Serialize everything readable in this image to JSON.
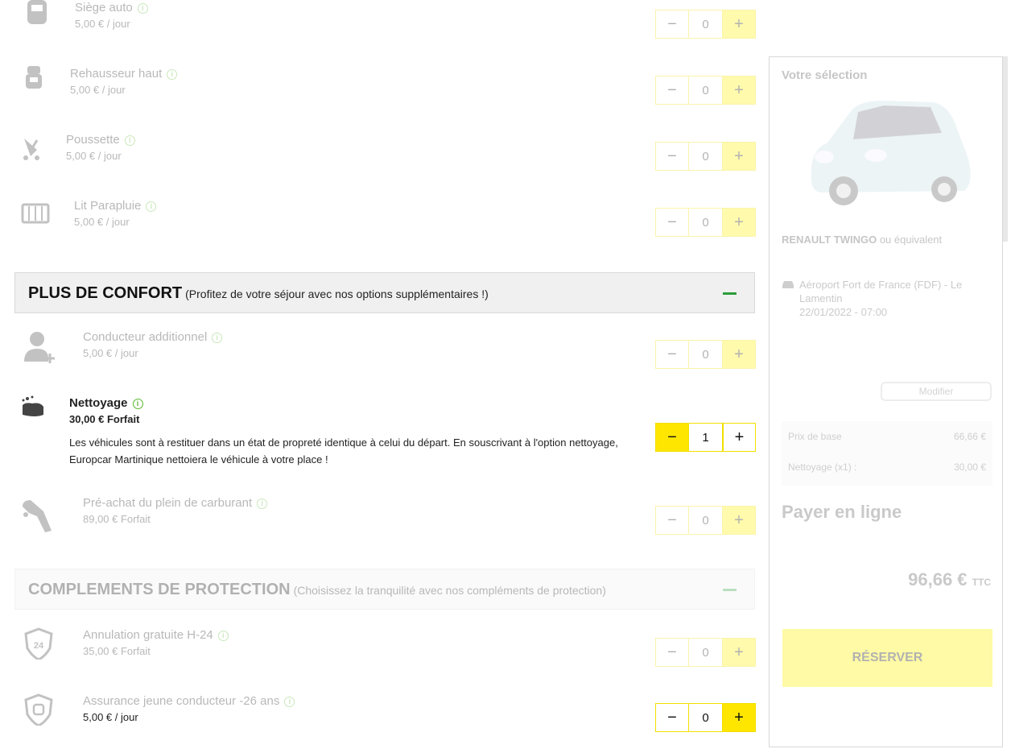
{
  "options_top": [
    {
      "name": "Siège auto",
      "price": "5,00 € / jour",
      "qty": "0",
      "icon": "car-seat-icon"
    },
    {
      "name": "Rehausseur haut",
      "price": "5,00 € / jour",
      "qty": "0",
      "icon": "booster-seat-icon"
    },
    {
      "name": "Poussette",
      "price": "5,00 € / jour",
      "qty": "0",
      "icon": "stroller-icon"
    },
    {
      "name": "Lit Parapluie",
      "price": "5,00 € / jour",
      "qty": "0",
      "icon": "travel-cot-icon"
    }
  ],
  "section_comfort": {
    "title": "PLUS DE CONFORT",
    "subtitle": "(Profitez de votre séjour avec nos options supplémentaires !)"
  },
  "options_comfort": [
    {
      "name": "Conducteur additionnel",
      "price": "5,00 € / jour",
      "qty": "0",
      "icon": "additional-driver-icon"
    },
    {
      "name": "Nettoyage",
      "price": "30,00 € Forfait",
      "qty": "1",
      "icon": "cleaning-icon",
      "description": "Les véhicules sont à restituer dans un état de propreté identique à celui du départ. En souscrivant à l'option nettoyage, Europcar Martinique nettoiera le véhicule à votre place !"
    },
    {
      "name": "Pré-achat du plein de carburant",
      "price": "89,00 € Forfait",
      "qty": "0",
      "icon": "fuel-pump-icon"
    }
  ],
  "section_protection": {
    "title": "COMPLEMENTS DE PROTECTION",
    "subtitle": "(Choisissez la tranquilité avec nos compléments de protection)"
  },
  "options_protection": [
    {
      "name": "Annulation gratuite H-24",
      "price": "35,00 € Forfait",
      "qty": "0",
      "icon": "shield-24h-icon"
    },
    {
      "name": "Assurance jeune conducteur -26 ans",
      "price": "5,00 € / jour",
      "qty": "0",
      "icon": "shield-driver-icon"
    }
  ],
  "sidebar": {
    "title": "Votre sélection",
    "car_model": "RENAULT TWINGO",
    "car_suffix": "ou équivalent",
    "pickup": {
      "place": "Aéroport Fort de France (FDF) - Le Lamentin",
      "datetime": "22/01/2022 - 07:00"
    },
    "modify_label": "Modifier",
    "price_lines": [
      {
        "label": "Prix de base",
        "value": "66,66 €"
      },
      {
        "label": "Nettoyage (x1) :",
        "value": "30,00 €"
      }
    ],
    "pay_title": "Payer en ligne",
    "total": "96,66 €",
    "total_suffix": "TTC",
    "reserve_label": "RÉSERVER"
  }
}
